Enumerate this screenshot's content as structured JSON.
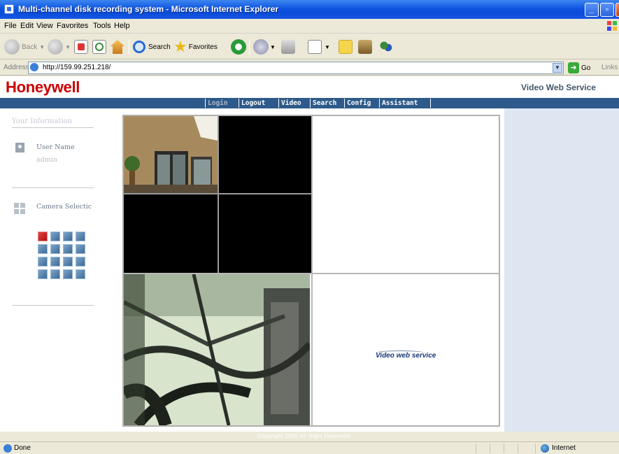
{
  "window": {
    "title": "Multi-channel disk recording system - Microsoft Internet Explorer"
  },
  "menu": [
    "File",
    "Edit",
    "View",
    "Favorites",
    "Tools",
    "Help"
  ],
  "toolbar": {
    "back_label": "Back",
    "search_label": "Search",
    "favorites_label": "Favorites"
  },
  "address": {
    "label": "Address",
    "url": "http://159.99.251.218/",
    "go_label": "Go",
    "links_label": "Links"
  },
  "page": {
    "brand": "Honeywell",
    "service_title": "Video Web Service",
    "nav": [
      "Login",
      "Logout",
      "Video",
      "Search",
      "Config",
      "Assistant"
    ],
    "active_nav": "Login",
    "left": {
      "heading": "Your Information",
      "user_label": "User Name",
      "user_value": "admin",
      "camera_selection_label": "Camera Selectic",
      "active_camera": "01"
    },
    "watermark": "Video web service",
    "footer": "Copyright 2005 All Right Reserved"
  },
  "status": {
    "text": "Done",
    "zone": "Internet"
  },
  "colors": {
    "brand_red": "#cc0000",
    "nav_blue": "#2d5a8a",
    "titlebar_blue": "#0f55e2",
    "active_camera": "#cc1a1a"
  }
}
